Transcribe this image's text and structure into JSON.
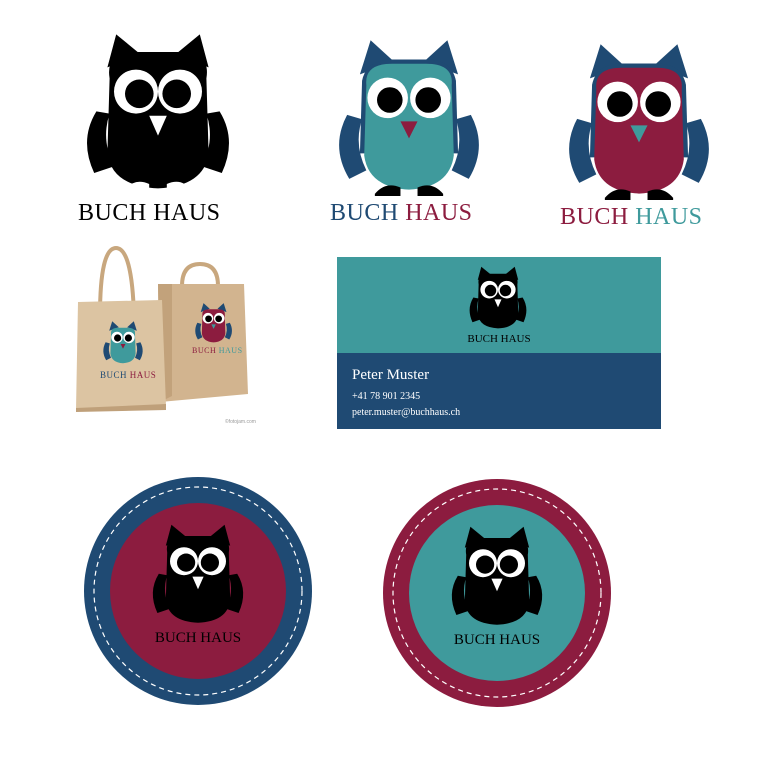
{
  "brand": {
    "word1": "BUCH",
    "word2": "HAUS"
  },
  "business_card": {
    "brand_word1": "BUCH",
    "brand_word2": "HAUS",
    "name": "Peter Muster",
    "phone": "+41 78 901 2345",
    "email": "peter.muster@buchhaus.ch"
  },
  "bags": {
    "watermark": "©fotojam.com"
  },
  "badges": {
    "badge1_word1": "BUCH",
    "badge1_word2": "HAUS",
    "badge2_word1": "BUCH",
    "badge2_word2": "HAUS"
  },
  "colors": {
    "navy": "#1f4a73",
    "teal": "#3f9a9c",
    "crimson": "#8c1c3f",
    "black": "#000000",
    "kraft": "#d8bf9d"
  },
  "variants": [
    {
      "name": "black",
      "body": "#000000",
      "ears": "#000000",
      "beak": "#ffffff",
      "word1_color": "#000000",
      "word2_color": "#000000"
    },
    {
      "name": "teal",
      "body": "#3f9a9c",
      "ears": "#1f4a73",
      "beak": "#8c1c3f",
      "word1_color": "#1f4a73",
      "word2_color": "#8c1c3f"
    },
    {
      "name": "crimson",
      "body": "#8c1c3f",
      "ears": "#1f4a73",
      "beak": "#3f9a9c",
      "word1_color": "#8c1c3f",
      "word2_color": "#3f9a9c"
    }
  ]
}
